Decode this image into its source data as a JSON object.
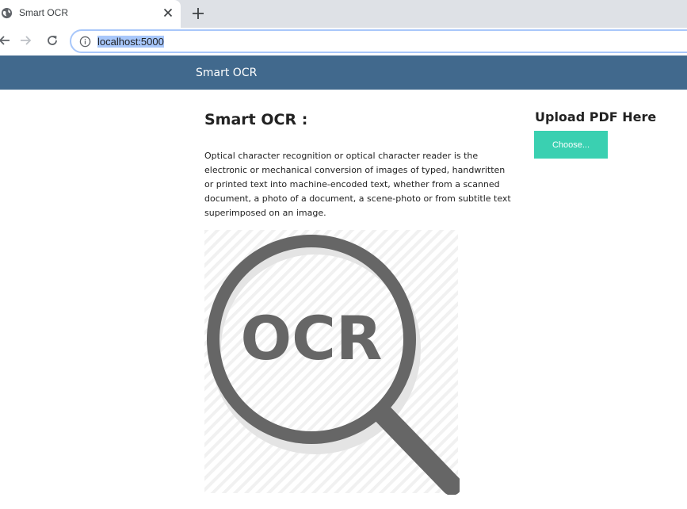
{
  "browser": {
    "tab_title": "Smart OCR",
    "url": "localhost:5000"
  },
  "navbar": {
    "brand": "Smart OCR",
    "color": "#41698d"
  },
  "main": {
    "title": "Smart OCR :",
    "description": "Optical character recognition or optical character reader is the electronic or mechanical conversion of images of typed, handwritten or printed text into machine-encoded text, whether from a scanned document, a photo of a document, a scene-photo or from subtitle text superimposed on an image.",
    "image_text": "OCR"
  },
  "upload": {
    "heading": "Upload PDF Here",
    "button_label": "Choose...",
    "button_color": "#3ad0b1"
  },
  "icons": {
    "favicon": "globe-icon",
    "close": "close-icon",
    "new_tab": "plus-icon",
    "back": "arrow-left-icon",
    "forward": "arrow-right-icon",
    "reload": "reload-icon",
    "info": "info-icon",
    "image": "magnifier-icon"
  }
}
